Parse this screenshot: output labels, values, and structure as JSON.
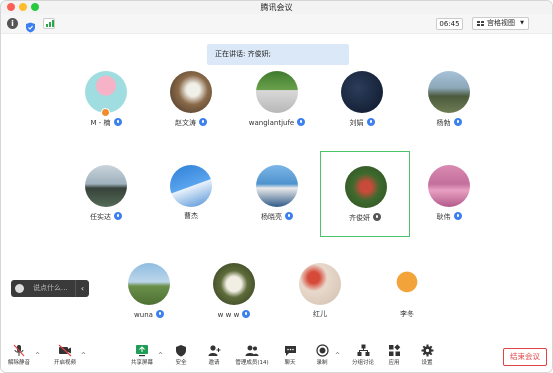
{
  "window": {
    "title": "腾讯会议"
  },
  "toolbar": {
    "timer": "06:45",
    "view_label": "宫格视图"
  },
  "speaking": {
    "label": "正在讲话: 齐俊妍;"
  },
  "participants": [
    {
      "name": "M - 楠"
    },
    {
      "name": "赵文涛"
    },
    {
      "name": "wanglantjufe"
    },
    {
      "name": "刘娟"
    },
    {
      "name": "杨勃"
    },
    {
      "name": "任实达"
    },
    {
      "name": "曹杰"
    },
    {
      "name": "杨晓亮"
    },
    {
      "name": "齐俊妍"
    },
    {
      "name": "耿伟"
    },
    {
      "name": "wuna"
    },
    {
      "name": "w w w"
    },
    {
      "name": "红儿"
    },
    {
      "name": "李冬"
    }
  ],
  "chat": {
    "placeholder": "说点什么..."
  },
  "bottombar": {
    "unmute": "解除静音",
    "video": "开启视频",
    "share": "共享屏幕",
    "security": "安全",
    "invite": "邀请",
    "manage": "管理成员(14)",
    "chat": "聊天",
    "record": "录制",
    "breakout": "分组讨论",
    "apps": "应用",
    "settings": "设置",
    "end": "结束会议"
  },
  "colors": {
    "mic_blue": "#3b7ff0",
    "active_border": "#4cc26a",
    "end_red": "#e04545"
  }
}
